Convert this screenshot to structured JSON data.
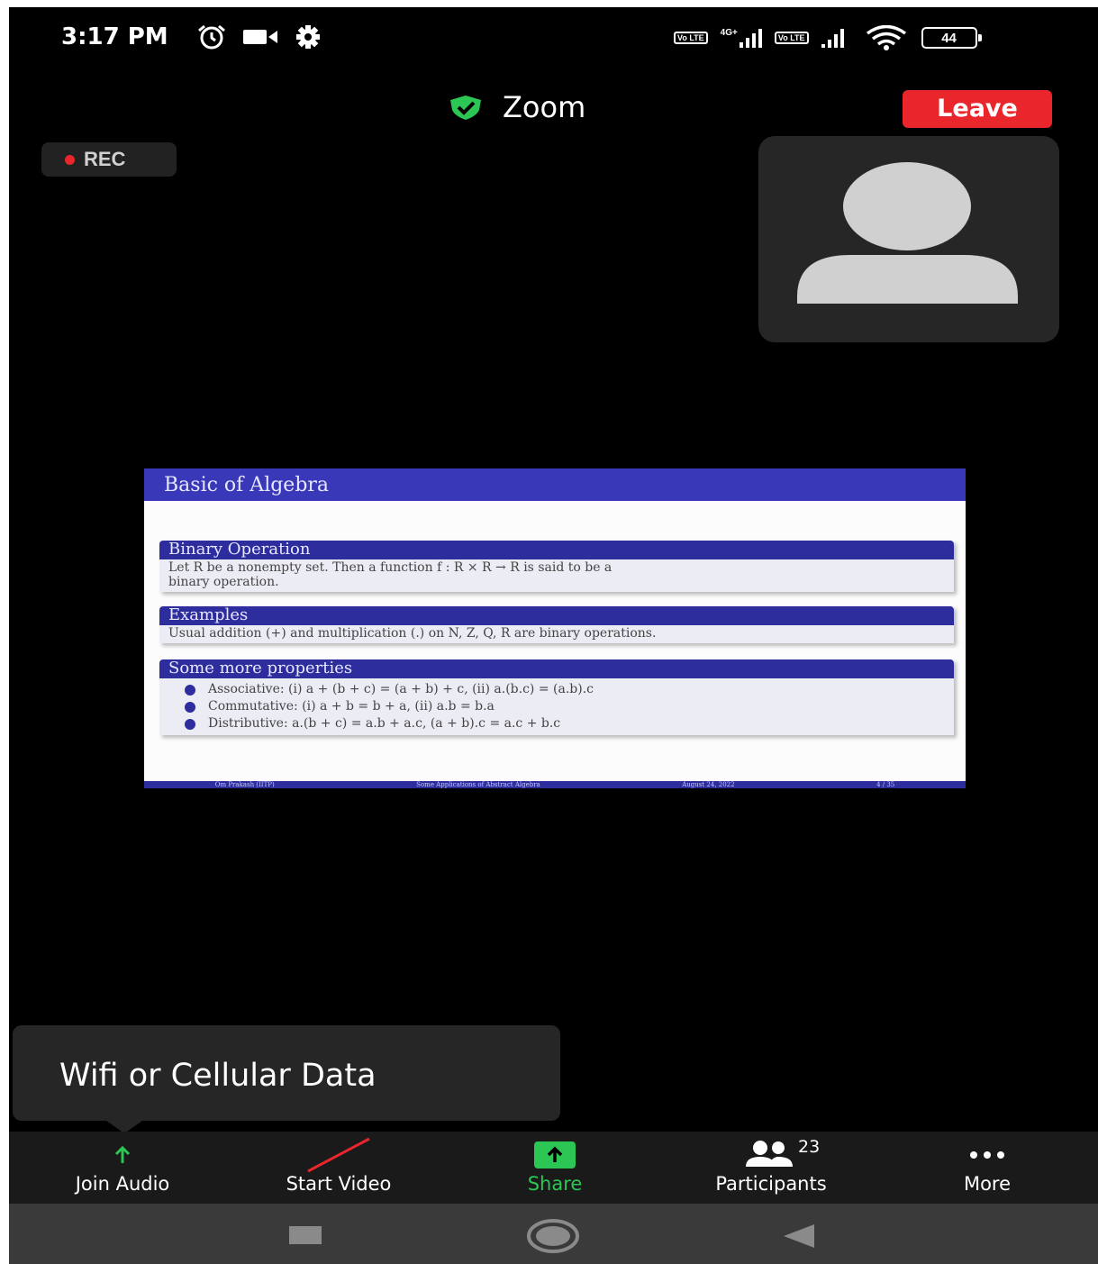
{
  "status_bar": {
    "time": "3:17 PM",
    "left_icons": [
      "alarm-icon",
      "video-camera-icon",
      "settings-icon"
    ],
    "network_label": "4G+",
    "volte_label": "Vo LTE",
    "battery": "44"
  },
  "header": {
    "title": "Zoom",
    "leave_label": "Leave",
    "shield_color": "#2bc653",
    "leave_color": "#e8262b"
  },
  "recording": {
    "label": "REC"
  },
  "slide": {
    "title": "Basic of Algebra",
    "blocks": [
      {
        "heading": "Binary Operation",
        "lines": [
          "Let R be a nonempty set. Then a function f : R × R → R is said to be a",
          "binary operation."
        ]
      },
      {
        "heading": "Examples",
        "lines": [
          "Usual addition (+) and multiplication (.) on N, Z, Q, R are binary operations."
        ]
      },
      {
        "heading": "Some more properties",
        "lines": [
          "Associative: (i) a + (b + c) = (a + b) + c, (ii) a.(b.c) = (a.b).c",
          "Commutative: (i) a + b = b + a, (ii) a.b = b.a",
          "Distributive: a.(b + c) = a.b + a.c, (a + b).c = a.c + b.c"
        ]
      }
    ],
    "footer": [
      "Om Prakash (IITP)",
      "Some Applications of Abstract Algebra",
      "August 24, 2022",
      "4 / 35"
    ]
  },
  "tooltip": {
    "text": "Wifi or Cellular Data"
  },
  "toolbar": {
    "join_audio": "Join Audio",
    "start_video": "Start Video",
    "share": "Share",
    "participants": "Participants",
    "participants_count": "23",
    "more": "More",
    "share_color": "#2bc653"
  },
  "navigation": {
    "items": [
      "recent-apps-icon",
      "home-icon",
      "back-icon"
    ]
  }
}
